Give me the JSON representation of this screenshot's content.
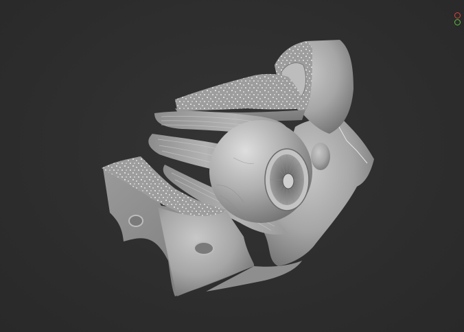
{
  "viewport": {
    "background_color": "#2d2d2d",
    "model_color": "#a9a9a9"
  },
  "gizmo": {
    "buttons": [
      {
        "icon": "red-circle-icon",
        "color": "#e0443c"
      },
      {
        "icon": "green-circle-icon",
        "color": "#5cc23c"
      }
    ]
  }
}
